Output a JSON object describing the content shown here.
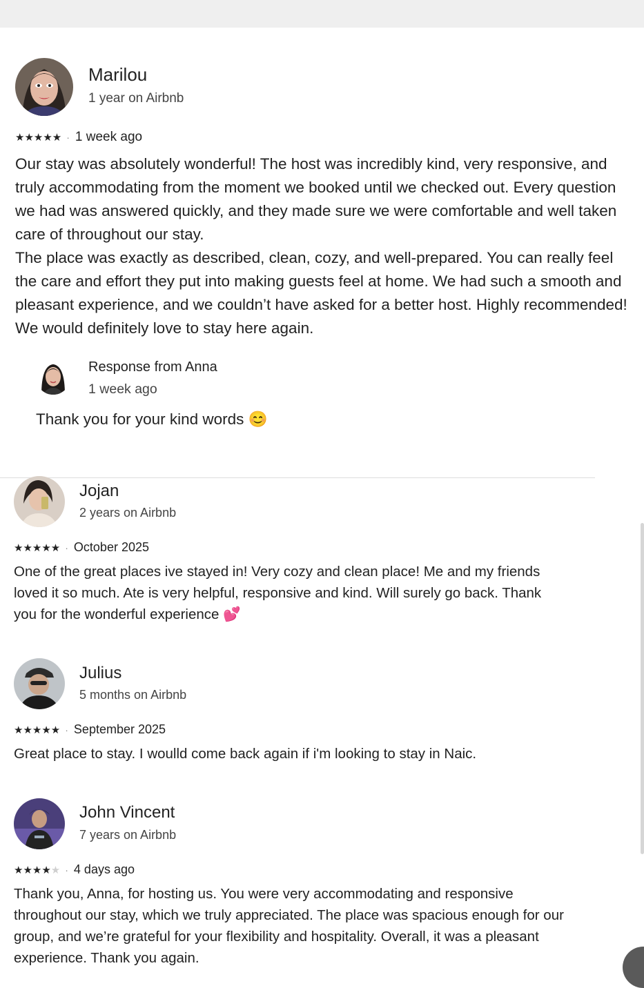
{
  "reviews": [
    {
      "name": "Marilou",
      "tenure": "1 year on Airbnb",
      "rating": 5,
      "stars_display": "★★★★★",
      "date": "1 week ago",
      "text_p1": "Our stay was absolutely wonderful! The host was incredibly kind, very responsive, and truly accommodating from the moment we booked until we checked out. Every question we had was answered quickly, and they made sure we were comfortable and well taken care of throughout our stay.",
      "text_p2": "The place was exactly as described, clean, cozy, and well-prepared. You can really feel the care and effort they put into making guests feel at home. We had such a smooth and pleasant experience, and we couldn’t have asked for a better host. Highly recommended! We would definitely love to stay here again.",
      "response": {
        "title": "Response from Anna",
        "date": "1 week ago",
        "text": "Thank you for your kind words 😊"
      }
    },
    {
      "name": "Jojan",
      "tenure": "2 years on Airbnb",
      "rating": 5,
      "stars_display": "★★★★★",
      "date": "October 2025",
      "text": "One of the great places ive stayed in! Very cozy and clean place! Me and my friends loved it so much. Ate is very helpful, responsive and kind. Will surely go back. Thank you for the wonderful experience 💕"
    },
    {
      "name": "Julius",
      "tenure": "5 months on Airbnb",
      "rating": 5,
      "stars_display": "★★★★★",
      "date": "September 2025",
      "text": "Great place to stay. I woulld come back again if i'm looking to stay in Naic."
    },
    {
      "name": "John Vincent",
      "tenure": "7 years on Airbnb",
      "rating": 4,
      "stars_display": "★★★★",
      "stars_off_display": "★",
      "date": "4 days ago",
      "text": "Thank you, Anna, for hosting us. You were very accommodating and responsive throughout our stay, which we truly appreciated. The place was spacious enough for our group, and we’re grateful for your flexibility and hospitality. Overall, it was a pleasant experience. Thank you again."
    }
  ],
  "separator": "·"
}
